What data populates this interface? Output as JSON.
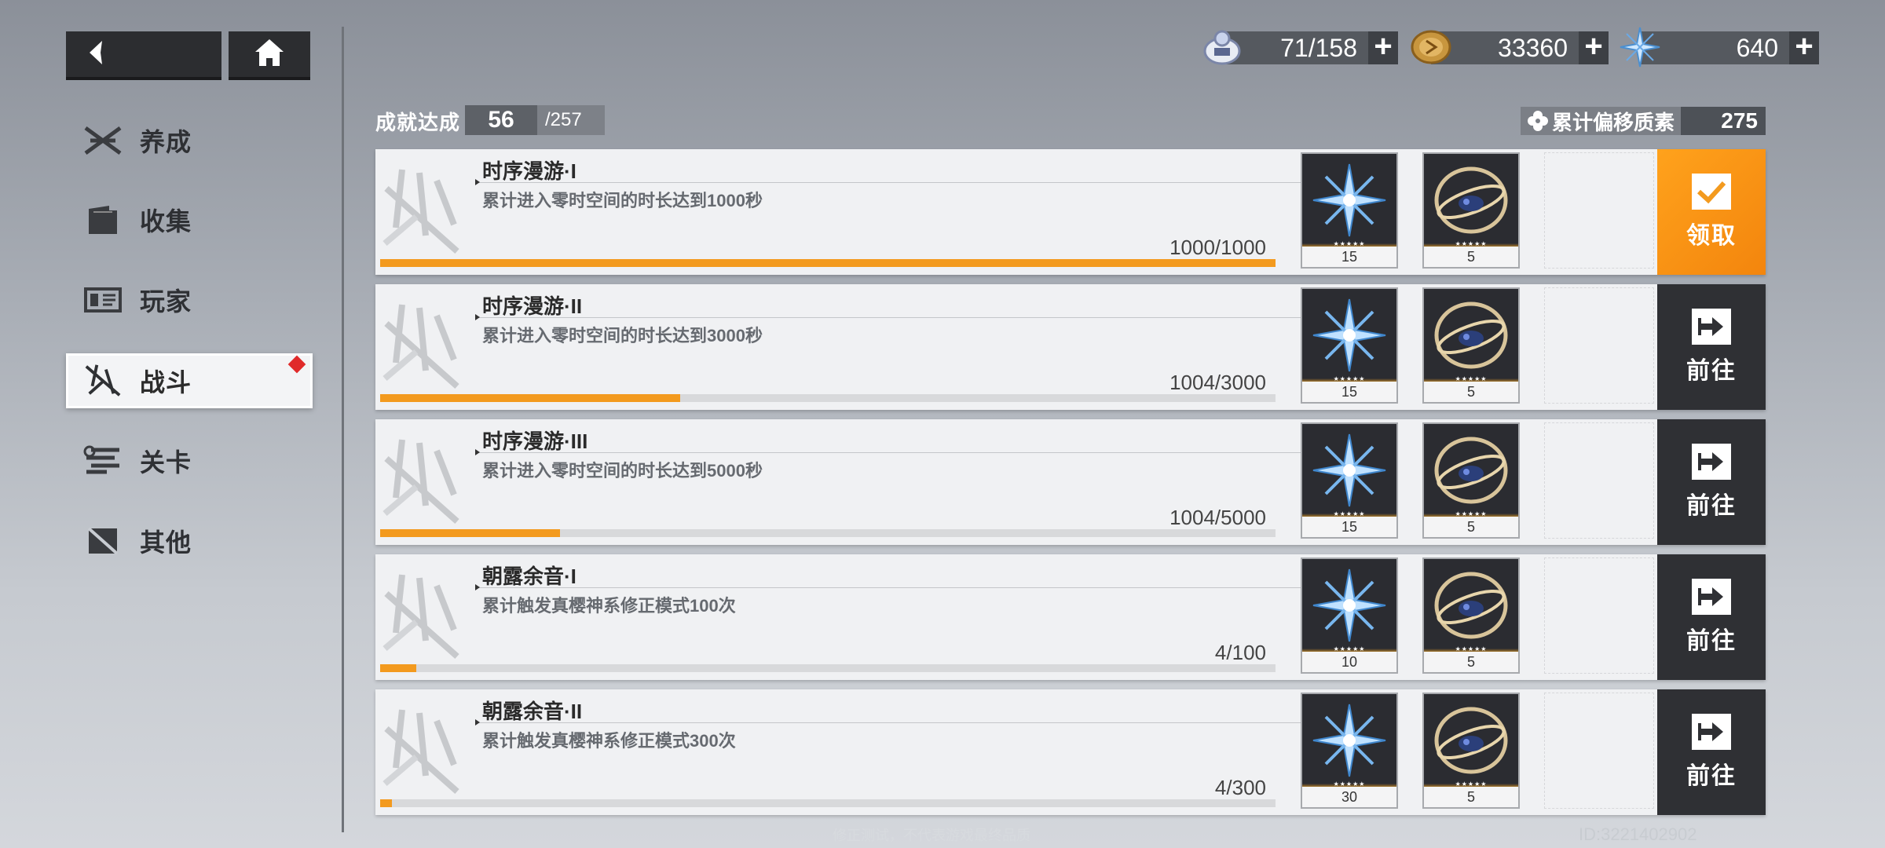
{
  "nav": {
    "back_icon": "back-arrow-icon",
    "home_icon": "home-icon"
  },
  "sidebar": {
    "items": [
      {
        "label": "养成",
        "icon": "crossed-blades-icon"
      },
      {
        "label": "收集",
        "icon": "folder-icon"
      },
      {
        "label": "玩家",
        "icon": "id-card-icon"
      },
      {
        "label": "战斗",
        "icon": "battle-icon",
        "active": true,
        "badge": "red-diamond"
      },
      {
        "label": "关卡",
        "icon": "stages-icon"
      },
      {
        "label": "其他",
        "icon": "other-icon"
      }
    ]
  },
  "resources": [
    {
      "icon": "stamina-icon",
      "value": "71/158"
    },
    {
      "icon": "coin-icon",
      "value": "33360"
    },
    {
      "icon": "crystal-icon",
      "value": "640"
    }
  ],
  "header": {
    "achievement_label": "成就达成",
    "achieved": "56",
    "total": "/257",
    "offset_label": "累计偏移质素",
    "offset_value": "275"
  },
  "rows": [
    {
      "title": "时序漫游·I",
      "desc": "累计进入零时空间的时长达到1000秒",
      "progress": "1000/1000",
      "fraction": 1.0,
      "rewards": [
        {
          "icon": "crystal-icon",
          "count": "15"
        },
        {
          "icon": "ring-artifact-icon",
          "count": "5"
        }
      ],
      "action": {
        "type": "claim",
        "label": "领取",
        "icon": "check-icon"
      }
    },
    {
      "title": "时序漫游·II",
      "desc": "累计进入零时空间的时长达到3000秒",
      "progress": "1004/3000",
      "fraction": 0.3347,
      "rewards": [
        {
          "icon": "crystal-icon",
          "count": "15"
        },
        {
          "icon": "ring-artifact-icon",
          "count": "5"
        }
      ],
      "action": {
        "type": "go",
        "label": "前往",
        "icon": "arrow-right-icon"
      }
    },
    {
      "title": "时序漫游·III",
      "desc": "累计进入零时空间的时长达到5000秒",
      "progress": "1004/5000",
      "fraction": 0.2008,
      "rewards": [
        {
          "icon": "crystal-icon",
          "count": "15"
        },
        {
          "icon": "ring-artifact-icon",
          "count": "5"
        }
      ],
      "action": {
        "type": "go",
        "label": "前往",
        "icon": "arrow-right-icon"
      }
    },
    {
      "title": "朝露余音·I",
      "desc": "累计触发真樱神系修正模式100次",
      "progress": "4/100",
      "fraction": 0.04,
      "rewards": [
        {
          "icon": "crystal-icon",
          "count": "10"
        },
        {
          "icon": "ring-artifact-icon",
          "count": "5"
        }
      ],
      "action": {
        "type": "go",
        "label": "前往",
        "icon": "arrow-right-icon"
      }
    },
    {
      "title": "朝露余音·II",
      "desc": "累计触发真樱神系修正模式300次",
      "progress": "4/300",
      "fraction": 0.0133,
      "rewards": [
        {
          "icon": "crystal-icon",
          "count": "30"
        },
        {
          "icon": "ring-artifact-icon",
          "count": "5"
        }
      ],
      "action": {
        "type": "go",
        "label": "前往",
        "icon": "arrow-right-icon"
      }
    }
  ],
  "footer": {
    "note": "修正测试，不代表游戏最终品质",
    "id": "ID:3221402902"
  },
  "colors": {
    "accent": "#f39a1e",
    "dark": "#2f3034",
    "badge": "#e02a2a"
  }
}
